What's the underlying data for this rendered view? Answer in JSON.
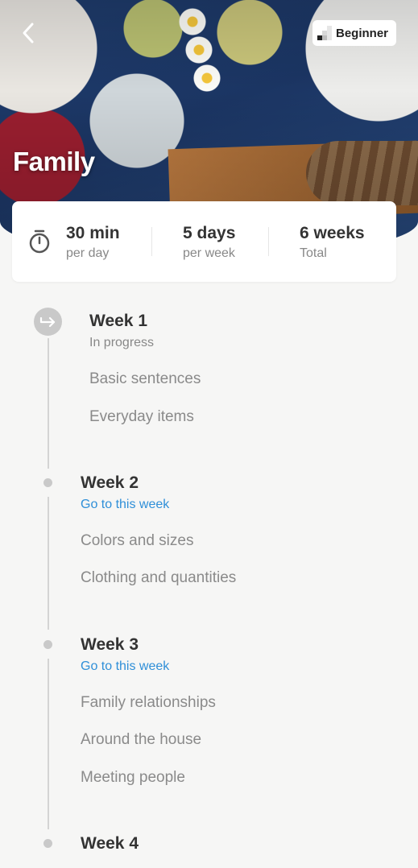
{
  "header": {
    "title": "Family",
    "level": "Beginner"
  },
  "stats": [
    {
      "value": "30 min",
      "label": "per day"
    },
    {
      "value": "5 days",
      "label": "per week"
    },
    {
      "value": "6 weeks",
      "label": "Total"
    }
  ],
  "weeks": [
    {
      "title": "Week 1",
      "status": "In progress",
      "topics": [
        "Basic sentences",
        "Everyday items"
      ]
    },
    {
      "title": "Week 2",
      "link": "Go to this week",
      "topics": [
        "Colors and sizes",
        "Clothing and quantities"
      ]
    },
    {
      "title": "Week 3",
      "link": "Go to this week",
      "topics": [
        "Family relationships",
        "Around the house",
        "Meeting people"
      ]
    },
    {
      "title": "Week 4"
    }
  ],
  "colors": {
    "accent_link": "#2f8fd8",
    "background": "#f6f6f5",
    "marker": "#c9c9c9"
  },
  "icons": {
    "back": "chevron-left-icon",
    "level": "level-bars-icon",
    "timer": "stopwatch-icon",
    "current": "arrow-return-icon"
  }
}
